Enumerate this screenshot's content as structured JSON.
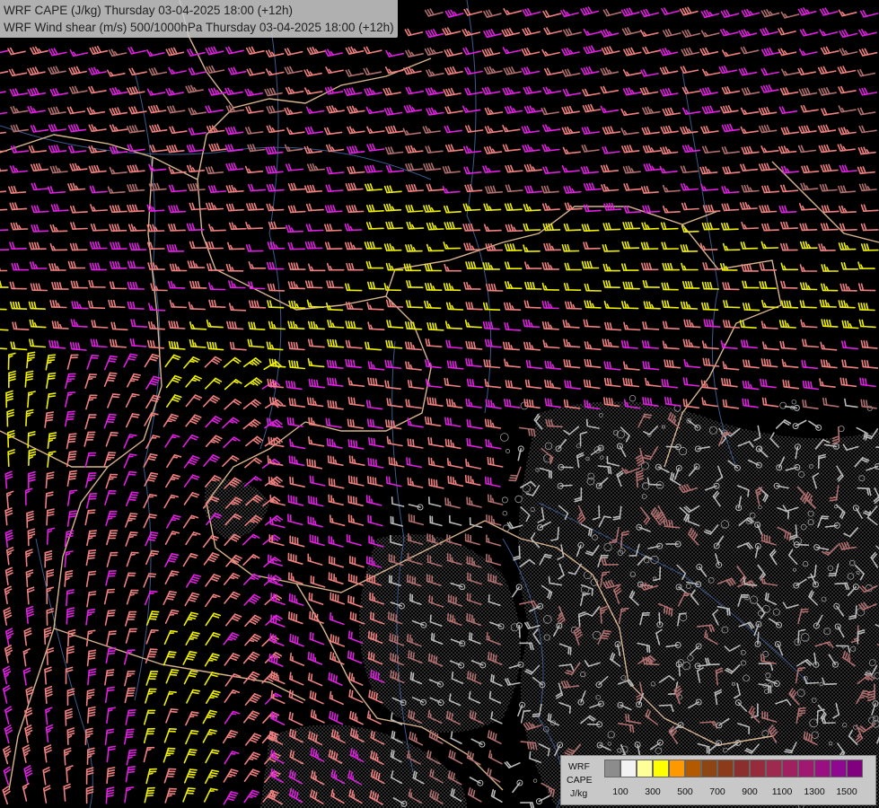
{
  "title": {
    "line1": "WRF CAPE (J/kg) Thursday 03-04-2025 18:00 (+12h)",
    "line2": "WRF Wind shear (m/s) 500/1000hPa Thursday 03-04-2025 18:00 (+12h)"
  },
  "legend": {
    "model": "WRF",
    "field": "CAPE",
    "unit": "J/kg",
    "colors": [
      "#8c8c8c",
      "#f2f2f2",
      "#ffff99",
      "#ffff00",
      "#ff9900",
      "#b35900",
      "#8c4513",
      "#8b3a1a",
      "#8b2e2e",
      "#952b3c",
      "#9e2a50",
      "#a02060",
      "#a01870",
      "#9b1080",
      "#8e0890",
      "#800080"
    ],
    "ticks": [
      "100",
      "300",
      "500",
      "700",
      "900",
      "1100",
      "1300",
      "1500"
    ]
  },
  "shear_colors": {
    "weak": "#b9b9b9",
    "moderate": "#b06e6e",
    "salmon": "#f08080",
    "magenta": "#e020e0",
    "yellow": "#f0f000"
  },
  "map_colors": {
    "background": "#000000",
    "borders": "#d9b48c",
    "rivers": "#3a5a90",
    "cape_hatch": "#8a8a8a"
  }
}
